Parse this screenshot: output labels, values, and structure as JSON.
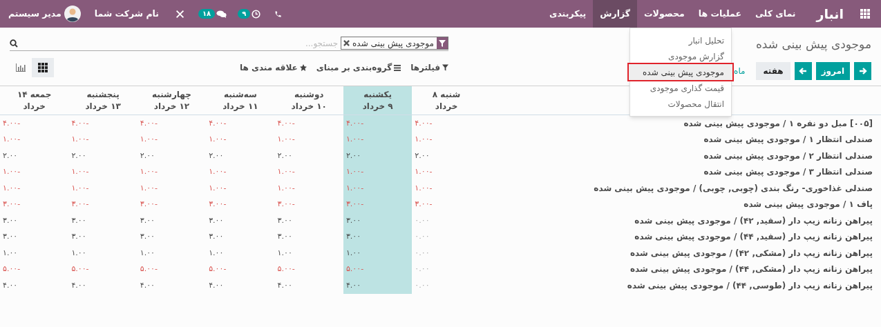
{
  "navbar": {
    "app_title": "انبار",
    "menu": [
      {
        "label": "نمای کلی",
        "selected": false
      },
      {
        "label": "عملیات ها",
        "selected": false
      },
      {
        "label": "محصولات",
        "selected": false
      },
      {
        "label": "گزارش",
        "selected": true
      },
      {
        "label": "پیکربندی",
        "selected": false
      }
    ],
    "systray": {
      "activity_count": "۹",
      "message_count": "۱۸",
      "company": "نام شرکت شما",
      "user": "مدیر سیستم"
    }
  },
  "report_menu": {
    "items": [
      {
        "label": "تحلیل انبار",
        "selected": false
      },
      {
        "label": "گزارش موجودی",
        "selected": false
      },
      {
        "label": "موجودی پیش بینی شده",
        "selected": true
      },
      {
        "label": "قیمت گذاری موجودی",
        "selected": false
      },
      {
        "label": "انتقال محصولات",
        "selected": false
      }
    ]
  },
  "breadcrumb": "موجودی پیش بینی شده",
  "search": {
    "facet": "موجودی پیش بینی شده",
    "placeholder": "جستجو..."
  },
  "today_button": "امروز",
  "scales": [
    {
      "label": "هفته",
      "selected": true
    },
    {
      "label": "ماه",
      "selected": false
    }
  ],
  "search_options": [
    {
      "kind": "filter",
      "label": "فیلترها"
    },
    {
      "kind": "groupby",
      "label": "گروه‌بندی بر مبنای"
    },
    {
      "kind": "favorites",
      "label": "علاقه مندی ها"
    }
  ],
  "views": [
    {
      "kind": "grid",
      "selected": true
    },
    {
      "kind": "graph",
      "selected": false
    }
  ],
  "columns": [
    {
      "line1": "شنبه ۸",
      "line2": "خرداد",
      "selected": false
    },
    {
      "line1": "یکشنبه",
      "line2": "۹ خرداد",
      "selected": true
    },
    {
      "line1": "دوشنبه",
      "line2": "۱۰ خرداد",
      "selected": false
    },
    {
      "line1": "سه‌شنبه",
      "line2": "۱۱ خرداد",
      "selected": false
    },
    {
      "line1": "چهارشنبه",
      "line2": "۱۲ خرداد",
      "selected": false
    },
    {
      "line1": "پنجشنبه",
      "line2": "۱۳ خرداد",
      "selected": false
    },
    {
      "line1": "جمعه ۱۴",
      "line2": "خرداد",
      "selected": false
    }
  ],
  "rows": [
    {
      "label": "[۰۰۵] مبل دو نفره ۱ / موجودی پیش بینی شده",
      "cells": [
        {
          "text": "۴.۰۰-",
          "kind": "negative"
        },
        {
          "text": "۴.۰۰-",
          "kind": "negative"
        },
        {
          "text": "۴.۰۰-",
          "kind": "negative"
        },
        {
          "text": "۴.۰۰-",
          "kind": "negative"
        },
        {
          "text": "۴.۰۰-",
          "kind": "negative"
        },
        {
          "text": "۴.۰۰-",
          "kind": "negative"
        },
        {
          "text": "۴.۰۰-",
          "kind": "negative"
        }
      ]
    },
    {
      "label": "صندلی انتظار ۱ / موجودی پیش بینی شده",
      "cells": [
        {
          "text": "۱.۰۰-",
          "kind": "negative"
        },
        {
          "text": "۱.۰۰-",
          "kind": "negative"
        },
        {
          "text": "۱.۰۰-",
          "kind": "negative"
        },
        {
          "text": "۱.۰۰-",
          "kind": "negative"
        },
        {
          "text": "۱.۰۰-",
          "kind": "negative"
        },
        {
          "text": "۱.۰۰-",
          "kind": "negative"
        },
        {
          "text": "۱.۰۰-",
          "kind": "negative"
        }
      ]
    },
    {
      "label": "صندلی انتظار ۲ / موجودی پیش بینی شده",
      "cells": [
        {
          "text": "۲.۰۰",
          "kind": "positive"
        },
        {
          "text": "۲.۰۰",
          "kind": "positive"
        },
        {
          "text": "۲.۰۰",
          "kind": "positive"
        },
        {
          "text": "۲.۰۰",
          "kind": "positive"
        },
        {
          "text": "۲.۰۰",
          "kind": "positive"
        },
        {
          "text": "۲.۰۰",
          "kind": "positive"
        },
        {
          "text": "۲.۰۰",
          "kind": "positive"
        }
      ]
    },
    {
      "label": "صندلی انتظار ۳ / موجودی پیش بینی شده",
      "cells": [
        {
          "text": "۱.۰۰-",
          "kind": "negative"
        },
        {
          "text": "۱.۰۰-",
          "kind": "negative"
        },
        {
          "text": "۱.۰۰-",
          "kind": "negative"
        },
        {
          "text": "۱.۰۰-",
          "kind": "negative"
        },
        {
          "text": "۱.۰۰-",
          "kind": "negative"
        },
        {
          "text": "۱.۰۰-",
          "kind": "negative"
        },
        {
          "text": "۱.۰۰-",
          "kind": "negative"
        }
      ]
    },
    {
      "label": "صندلی غذاخوری- رنگ بندی (چوبی, چوبی) / موجودی پیش بینی شده",
      "cells": [
        {
          "text": "۱.۰۰-",
          "kind": "negative"
        },
        {
          "text": "۱.۰۰-",
          "kind": "negative"
        },
        {
          "text": "۱.۰۰-",
          "kind": "negative"
        },
        {
          "text": "۱.۰۰-",
          "kind": "negative"
        },
        {
          "text": "۱.۰۰-",
          "kind": "negative"
        },
        {
          "text": "۱.۰۰-",
          "kind": "negative"
        },
        {
          "text": "۱.۰۰-",
          "kind": "negative"
        }
      ]
    },
    {
      "label": "پاف ۱ / موجودی پیش بینی شده",
      "cells": [
        {
          "text": "۳.۰۰-",
          "kind": "negative"
        },
        {
          "text": "۳.۰۰-",
          "kind": "negative"
        },
        {
          "text": "۳.۰۰-",
          "kind": "negative"
        },
        {
          "text": "۳.۰۰-",
          "kind": "negative"
        },
        {
          "text": "۳.۰۰-",
          "kind": "negative"
        },
        {
          "text": "۳.۰۰-",
          "kind": "negative"
        },
        {
          "text": "۳.۰۰-",
          "kind": "negative"
        }
      ]
    },
    {
      "label": "پیراهن زنانه زیپ دار (سفید, ۴۲) / موجودی پیش بینی شده",
      "cells": [
        {
          "text": "۰.۰۰",
          "kind": "zero"
        },
        {
          "text": "۳.۰۰",
          "kind": "positive"
        },
        {
          "text": "۳.۰۰",
          "kind": "positive"
        },
        {
          "text": "۳.۰۰",
          "kind": "positive"
        },
        {
          "text": "۳.۰۰",
          "kind": "positive"
        },
        {
          "text": "۳.۰۰",
          "kind": "positive"
        },
        {
          "text": "۳.۰۰",
          "kind": "positive"
        }
      ]
    },
    {
      "label": "پیراهن زنانه زیپ دار (سفید, ۴۴) / موجودی پیش بینی شده",
      "cells": [
        {
          "text": "۰.۰۰",
          "kind": "zero"
        },
        {
          "text": "۳.۰۰",
          "kind": "positive"
        },
        {
          "text": "۳.۰۰",
          "kind": "positive"
        },
        {
          "text": "۳.۰۰",
          "kind": "positive"
        },
        {
          "text": "۳.۰۰",
          "kind": "positive"
        },
        {
          "text": "۳.۰۰",
          "kind": "positive"
        },
        {
          "text": "۳.۰۰",
          "kind": "positive"
        }
      ]
    },
    {
      "label": "پیراهن زنانه زیپ دار (مشکی, ۴۲) / موجودی پیش بینی شده",
      "cells": [
        {
          "text": "۰.۰۰",
          "kind": "zero"
        },
        {
          "text": "۱.۰۰",
          "kind": "positive"
        },
        {
          "text": "۱.۰۰",
          "kind": "positive"
        },
        {
          "text": "۱.۰۰",
          "kind": "positive"
        },
        {
          "text": "۱.۰۰",
          "kind": "positive"
        },
        {
          "text": "۱.۰۰",
          "kind": "positive"
        },
        {
          "text": "۱.۰۰",
          "kind": "positive"
        }
      ]
    },
    {
      "label": "پیراهن زنانه زیپ دار (مشکی, ۴۴) / موجودی پیش بینی شده",
      "cells": [
        {
          "text": "۰.۰۰",
          "kind": "zero"
        },
        {
          "text": "۵.۰۰-",
          "kind": "negative"
        },
        {
          "text": "۵.۰۰-",
          "kind": "negative"
        },
        {
          "text": "۵.۰۰-",
          "kind": "negative"
        },
        {
          "text": "۵.۰۰-",
          "kind": "negative"
        },
        {
          "text": "۵.۰۰-",
          "kind": "negative"
        },
        {
          "text": "۵.۰۰-",
          "kind": "negative"
        }
      ]
    },
    {
      "label": "پیراهن زنانه زیپ دار (طوسی, ۴۴) / موجودی پیش بینی شده",
      "cells": [
        {
          "text": "۰.۰۰",
          "kind": "zero"
        },
        {
          "text": "۴.۰۰",
          "kind": "positive"
        },
        {
          "text": "۴.۰۰",
          "kind": "positive"
        },
        {
          "text": "۴.۰۰",
          "kind": "positive"
        },
        {
          "text": "۴.۰۰",
          "kind": "positive"
        },
        {
          "text": "۴.۰۰",
          "kind": "positive"
        },
        {
          "text": "۴.۰۰",
          "kind": "positive"
        }
      ]
    }
  ]
}
